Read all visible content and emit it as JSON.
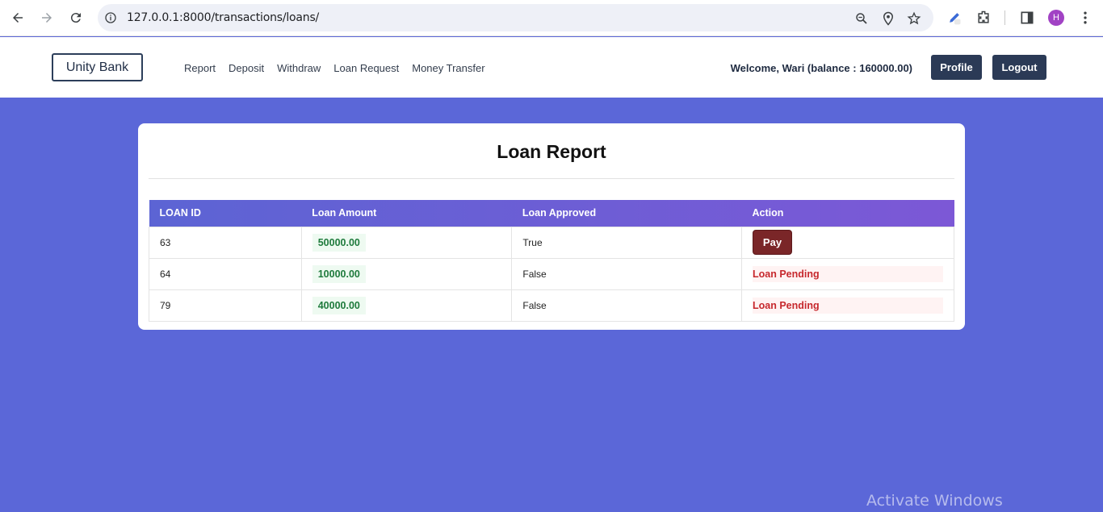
{
  "browser": {
    "url": "127.0.0.1:8000/transactions/loans/",
    "profile_initial": "H"
  },
  "site": {
    "brand": "Unity Bank",
    "nav": [
      "Report",
      "Deposit",
      "Withdraw",
      "Loan Request",
      "Money Transfer"
    ],
    "welcome": "Welcome, Wari (balance : 160000.00)",
    "profile_label": "Profile",
    "logout_label": "Logout"
  },
  "report": {
    "title": "Loan Report",
    "columns": [
      "LOAN ID",
      "Loan Amount",
      "Loan Approved",
      "Action"
    ],
    "rows": [
      {
        "id": "63",
        "amount": "50000.00",
        "approved": "True",
        "action": "Pay"
      },
      {
        "id": "64",
        "amount": "10000.00",
        "approved": "False",
        "action": "Loan Pending"
      },
      {
        "id": "79",
        "amount": "40000.00",
        "approved": "False",
        "action": "Loan Pending"
      }
    ]
  },
  "watermark": "Activate Windows",
  "colors": {
    "page_bg": "#5b67d8",
    "nav_button": "#2b3a56",
    "pay_button": "#7a2628",
    "pending_text": "#c6282d",
    "amount_text": "#1e7a3c"
  }
}
